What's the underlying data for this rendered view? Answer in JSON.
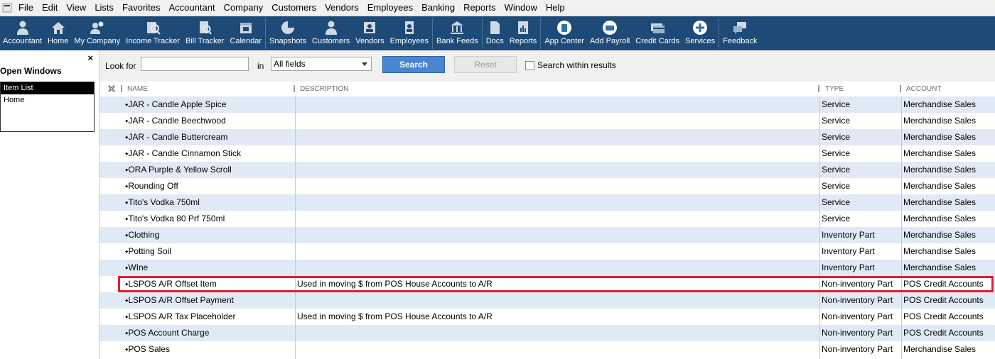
{
  "menubar": {
    "items": [
      "File",
      "Edit",
      "View",
      "Lists",
      "Favorites",
      "Accountant",
      "Company",
      "Customers",
      "Vendors",
      "Employees",
      "Banking",
      "Reports",
      "Window",
      "Help"
    ]
  },
  "toolbar": {
    "buttons": [
      {
        "label": "Accountant",
        "icon": "accountant-icon"
      },
      {
        "label": "Home",
        "icon": "home-icon"
      },
      {
        "label": "My Company",
        "icon": "my-company-icon"
      },
      {
        "label": "Income Tracker",
        "icon": "income-tracker-icon"
      },
      {
        "label": "Bill Tracker",
        "icon": "bill-tracker-icon"
      },
      {
        "label": "Calendar",
        "icon": "calendar-icon"
      },
      {
        "label": "Snapshots",
        "icon": "snapshots-icon"
      },
      {
        "label": "Customers",
        "icon": "customers-icon"
      },
      {
        "label": "Vendors",
        "icon": "vendors-icon"
      },
      {
        "label": "Employees",
        "icon": "employees-icon"
      },
      {
        "label": "Bank Feeds",
        "icon": "bank-feeds-icon"
      },
      {
        "label": "Docs",
        "icon": "docs-icon"
      },
      {
        "label": "Reports",
        "icon": "reports-icon"
      },
      {
        "label": "App Center",
        "icon": "app-center-icon"
      },
      {
        "label": "Add Payroll",
        "icon": "add-payroll-icon"
      },
      {
        "label": "Credit Cards",
        "icon": "credit-cards-icon"
      },
      {
        "label": "Services",
        "icon": "services-icon"
      },
      {
        "label": "Feedback",
        "icon": "feedback-icon"
      }
    ]
  },
  "left_panel": {
    "close": "×",
    "title": "Open Windows",
    "items": [
      "Item List",
      "Home"
    ]
  },
  "search": {
    "look_for_label": "Look for",
    "look_for_value": "",
    "in_label": "in",
    "field_value": "All fields",
    "search_label": "Search",
    "reset_label": "Reset",
    "within_label": "Search within results"
  },
  "table": {
    "headers": {
      "name": "NAME",
      "description": "DESCRIPTION",
      "type": "TYPE",
      "account": "ACCOUNT"
    },
    "rows": [
      {
        "name": "JAR - Candle Apple Spice",
        "description": "",
        "type": "Service",
        "account": "Merchandise Sales"
      },
      {
        "name": "JAR - Candle Beechwood",
        "description": "",
        "type": "Service",
        "account": "Merchandise Sales"
      },
      {
        "name": "JAR - Candle Buttercream",
        "description": "",
        "type": "Service",
        "account": "Merchandise Sales"
      },
      {
        "name": "JAR - Candle Cinnamon Stick",
        "description": "",
        "type": "Service",
        "account": "Merchandise Sales"
      },
      {
        "name": "ORA Purple & Yellow Scroll",
        "description": "",
        "type": "Service",
        "account": "Merchandise Sales"
      },
      {
        "name": "Rounding Off",
        "description": "",
        "type": "Service",
        "account": "Merchandise Sales"
      },
      {
        "name": "Tito's Vodka 750ml",
        "description": "",
        "type": "Service",
        "account": "Merchandise Sales"
      },
      {
        "name": "Tito's Vodka 80 Prf 750ml",
        "description": "",
        "type": "Service",
        "account": "Merchandise Sales"
      },
      {
        "name": "Clothing",
        "description": "",
        "type": "Inventory Part",
        "account": "Merchandise Sales"
      },
      {
        "name": "Potting Soil",
        "description": "",
        "type": "Inventory Part",
        "account": "Merchandise Sales"
      },
      {
        "name": "WIne",
        "description": "",
        "type": "Inventory Part",
        "account": "Merchandise Sales"
      },
      {
        "name": "LSPOS A/R Offset Item",
        "description": "Used in moving $ from POS House Accounts to A/R",
        "type": "Non-inventory Part",
        "account": "POS Credit Accounts"
      },
      {
        "name": "LSPOS A/R Offset Payment",
        "description": "",
        "type": "Non-inventory Part",
        "account": "POS Credit Accounts"
      },
      {
        "name": "LSPOS A/R Tax Placeholder",
        "description": "Used in moving $ from POS House Accounts to A/R",
        "type": "Non-inventory Part",
        "account": "POS Credit Accounts"
      },
      {
        "name": "POS Account Charge",
        "description": "",
        "type": "Non-inventory Part",
        "account": "POS Credit Accounts"
      },
      {
        "name": "POS Sales",
        "description": "",
        "type": "Non-inventory Part",
        "account": "Merchandise Sales"
      }
    ]
  },
  "colors": {
    "toolbar": "#1e4a77",
    "row_alt": "#dfeaf6",
    "highlight": "#e0202c",
    "search_button": "#4a86cf"
  }
}
